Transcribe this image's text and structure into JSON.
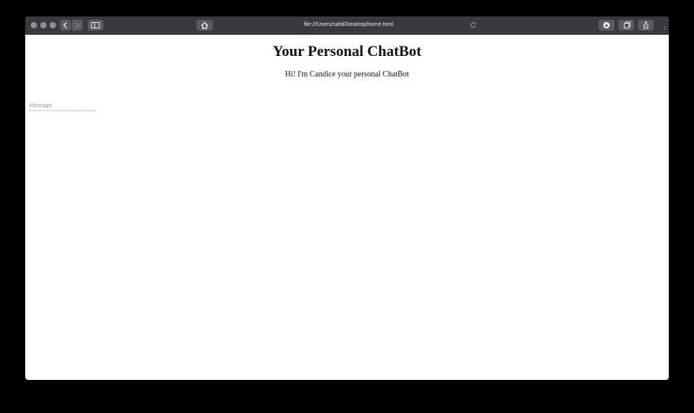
{
  "browser": {
    "url": "file:///Users/sahil/Desktop/home.html",
    "icons": {
      "back": "chevron-left-icon",
      "forward": "chevron-right-icon",
      "sidebar": "sidebar-icon",
      "home": "home-icon",
      "reload": "reload-icon",
      "download": "download-icon",
      "tabs": "tabs-icon",
      "share": "share-icon"
    }
  },
  "page": {
    "title": "Your Personal ChatBot",
    "subtitle": "Hi! I'm Candice your personal ChatBot",
    "message_input": {
      "placeholder": "Message",
      "value": ""
    }
  },
  "colors": {
    "toolbar": "#3a3a3c",
    "background": "#ffffff",
    "text": "#111111"
  }
}
